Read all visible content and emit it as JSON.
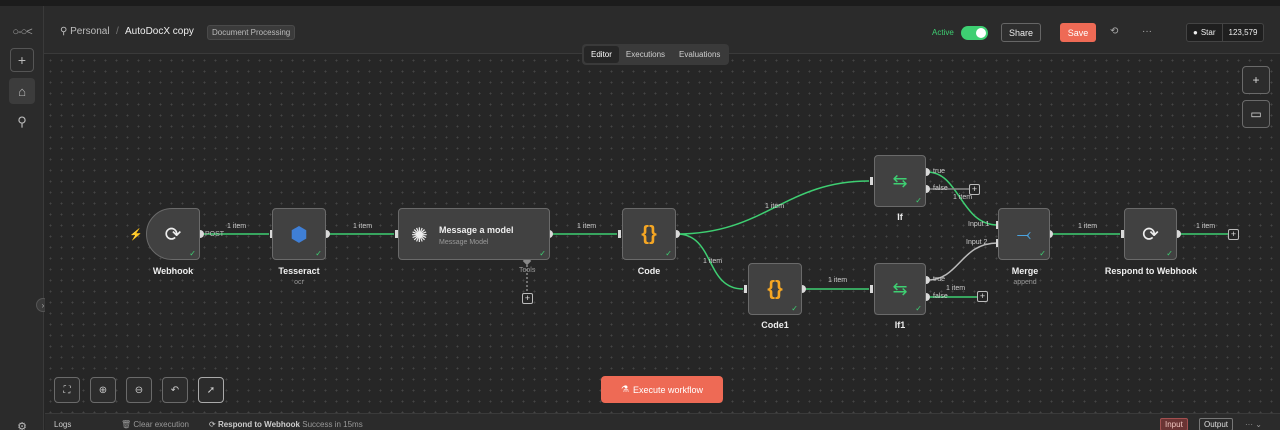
{
  "sidebar": {
    "logo_icon": "n8n-logo-icon"
  },
  "header": {
    "breadcrumb_project": "Personal",
    "workflow_name": "AutoDocX copy",
    "tag": "Document Processing",
    "active_label": "Active",
    "share_label": "Share",
    "save_label": "Save",
    "github_star": "Star",
    "github_count": "123,579"
  },
  "tabs": [
    "Editor",
    "Executions",
    "Evaluations"
  ],
  "nodes": {
    "webhook": {
      "label": "Webhook",
      "port": "POST"
    },
    "tesseract": {
      "label": "Tesseract",
      "sub": "ocr"
    },
    "message": {
      "title": "Message a model",
      "sub": "Message Model",
      "tools": "Tools"
    },
    "code": {
      "label": "Code"
    },
    "code1": {
      "label": "Code1"
    },
    "if": {
      "label": "If",
      "true": "true",
      "false": "false"
    },
    "if1": {
      "label": "If1",
      "true": "true",
      "false": "false"
    },
    "merge": {
      "label": "Merge",
      "sub": "append",
      "input1": "Input 1",
      "input2": "Input 2"
    },
    "respond": {
      "label": "Respond to Webhook"
    }
  },
  "edges": {
    "item_label": "1 item"
  },
  "canvas": {
    "execute_label": "Execute workflow"
  },
  "logs": {
    "title": "Logs",
    "clear": "Clear execution",
    "node": "Respond to Webhook",
    "status": "Success in 15ms",
    "input": "Input",
    "output": "Output"
  }
}
